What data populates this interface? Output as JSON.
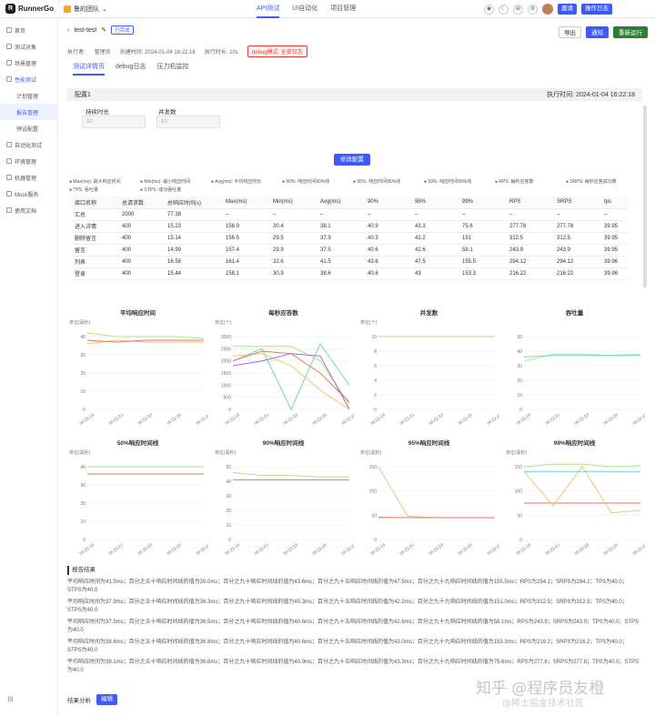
{
  "app": {
    "logo": "RunnerGo",
    "team": "鲁的团队",
    "nav": [
      "API测试",
      "UI自动化",
      "项目管理"
    ],
    "invite": "邀请",
    "log": "操作日志"
  },
  "sidebar": [
    "首页",
    "测试对象",
    "场景管理",
    "性能测试",
    "计划管理",
    "报告管理",
    "预设配置",
    "自动化测试",
    "环境管理",
    "机器管理",
    "Mock服务",
    "使用文档"
  ],
  "header": {
    "title": "test-test",
    "status": "已完成",
    "executor_label": "执行者:",
    "executor": "管理员",
    "created": "创建时间: 2024-01-04 16:22:18",
    "duration": "执行时长: 10s",
    "debug": "debug模式: 全部日志",
    "export": "导出",
    "notify": "通知",
    "rerun": "重新运行"
  },
  "tabs": [
    "测试详情页",
    "debug日志",
    "压力机监控"
  ],
  "panel": {
    "name": "配置1",
    "exec_time": "执行时间: 2024-01-04 16:22:18",
    "duration_label": "持续时长",
    "duration_val": "10",
    "conc_label": "并发数",
    "conc_val": "10",
    "modify": "修改配置"
  },
  "legend": [
    "Max(ms): 最大响应时间",
    "Min(ms): 最小响应时间",
    "Avg(ms): 平均响应时长",
    "90%: 响应时间90%线",
    "95%: 响应时间95%线",
    "99%: 响应时间99%线",
    "RPS: 每秒应答数",
    "SRPS: 每秒应答成功数",
    "TPS: 吞吐量",
    "STPS: 成功吞吐量"
  ],
  "table": {
    "headers": [
      "接口名称",
      "总请求数",
      "总响应时间(s)",
      "Max(ms)",
      "Min(ms)",
      "Avg(ms)",
      "90%",
      "95%",
      "99%",
      "RPS",
      "SRPS",
      "tps"
    ],
    "rows": [
      [
        "汇总",
        "2000",
        "77.38",
        "–",
        "–",
        "–",
        "–",
        "–",
        "–",
        "–",
        "–",
        "–"
      ],
      [
        "进入详情",
        "400",
        "15.23",
        "158.9",
        "30.4",
        "38.1",
        "40.9",
        "43.3",
        "75.6",
        "277.78",
        "277.78",
        "39.95"
      ],
      [
        "删除留言",
        "400",
        "15.14",
        "156.5",
        "29.5",
        "37.9",
        "40.3",
        "42.2",
        "151",
        "312.5",
        "312.5",
        "39.95"
      ],
      [
        "留言",
        "400",
        "14.99",
        "157.4",
        "29.9",
        "37.5",
        "40.6",
        "42.6",
        "58.1",
        "243.9",
        "243.9",
        "39.95"
      ],
      [
        "列表",
        "400",
        "16.58",
        "161.4",
        "32.6",
        "41.5",
        "43.6",
        "47.5",
        "155.5",
        "294.12",
        "294.12",
        "39.96"
      ],
      [
        "登录",
        "400",
        "15.44",
        "158.1",
        "30.9",
        "38.6",
        "40.6",
        "43",
        "153.3",
        "216.22",
        "216.22",
        "39.98"
      ]
    ]
  },
  "chart_data": [
    {
      "type": "line",
      "title": "平均响应时间",
      "ylabel": "单位(毫秒)",
      "ylim": [
        0,
        40
      ],
      "yticks": [
        "40",
        "30",
        "20",
        "10",
        "0"
      ],
      "x": [
        "16:22:19",
        "16:22:21",
        "16:22:23",
        "16:22:25",
        "16:22:27"
      ],
      "series": [
        {
          "color": "#b5e08a",
          "values": [
            45,
            40,
            40,
            40,
            39
          ]
        },
        {
          "color": "#f2c46d",
          "values": [
            36,
            38,
            37,
            37,
            37
          ]
        },
        {
          "color": "#e07a5f",
          "values": [
            38,
            37,
            38,
            38,
            38
          ]
        }
      ]
    },
    {
      "type": "line",
      "title": "每秒应答数",
      "ylabel": "单位(个)",
      "ylim": [
        0,
        3000
      ],
      "yticks": [
        "3000",
        "2500",
        "2000",
        "1500",
        "1000",
        "500",
        "0"
      ],
      "x": [
        "16:22:19",
        "16:22:21",
        "16:22:23",
        "16:22:25",
        "16:22:27"
      ],
      "series": [
        {
          "color": "#6fd6c9",
          "values": [
            2000,
            2500,
            0,
            2700,
            1000
          ]
        },
        {
          "color": "#b5e08a",
          "values": [
            2600,
            2600,
            2600,
            2000,
            200
          ]
        },
        {
          "color": "#f2c46d",
          "values": [
            2200,
            2300,
            1800,
            800,
            0
          ]
        },
        {
          "color": "#e07a5f",
          "values": [
            2000,
            2400,
            2300,
            1500,
            300
          ]
        },
        {
          "color": "#9c6bdc",
          "values": [
            1800,
            2000,
            2300,
            2200,
            0
          ]
        }
      ]
    },
    {
      "type": "line",
      "title": "并发数",
      "ylabel": "单位(个)",
      "ylim": [
        0,
        10
      ],
      "yticks": [
        "10",
        "8",
        "6",
        "4",
        "2",
        "0"
      ],
      "x": [
        "16:22:19",
        "16:22:21",
        "16:22:23",
        "16:22:25",
        "16:22:27"
      ],
      "series": [
        {
          "color": "#b5e08a",
          "values": [
            10,
            10,
            10,
            10,
            10
          ]
        }
      ]
    },
    {
      "type": "line",
      "title": "吞吐量",
      "ylabel": "",
      "ylim": [
        0,
        50
      ],
      "yticks": [
        "50",
        "40",
        "30",
        "20",
        "10",
        "0"
      ],
      "x": [
        "16:22:19",
        "16:22:21",
        "16:22:23",
        "16:22:25",
        "16:22:27"
      ],
      "series": [
        {
          "color": "#b5e08a",
          "values": [
            33,
            38,
            38,
            37,
            38
          ]
        },
        {
          "color": "#6fd6c9",
          "values": [
            36,
            37,
            37,
            37,
            37
          ]
        }
      ]
    },
    {
      "type": "line",
      "title": "50%响应时间线",
      "ylabel": "单位(毫秒)",
      "ylim": [
        0,
        40
      ],
      "yticks": [
        "40",
        "30",
        "20",
        "10",
        "0"
      ],
      "x": [
        "16:22:19",
        "16:22:21",
        "16:22:23",
        "16:22:25",
        "16:22:27"
      ],
      "series": [
        {
          "color": "#b5e08a",
          "values": [
            40,
            40,
            40,
            40,
            40
          ]
        },
        {
          "color": "#e07a5f",
          "values": [
            36,
            36,
            36,
            36,
            36
          ]
        }
      ]
    },
    {
      "type": "line",
      "title": "90%响应时间线",
      "ylabel": "单位(毫秒)",
      "ylim": [
        0,
        50
      ],
      "yticks": [
        "50",
        "40",
        "30",
        "20",
        "10",
        "0"
      ],
      "x": [
        "16:22:19",
        "16:22:21",
        "16:22:23",
        "16:22:25",
        "16:22:27"
      ],
      "series": [
        {
          "color": "#b5e08a",
          "values": [
            46,
            44,
            44,
            43,
            43
          ]
        },
        {
          "color": "#e07a5f",
          "values": [
            41,
            41,
            41,
            41,
            41
          ]
        }
      ]
    },
    {
      "type": "line",
      "title": "95%响应时间线",
      "ylabel": "单位(毫秒)",
      "ylim": [
        0,
        150
      ],
      "yticks": [
        "150",
        "100",
        "50",
        "0"
      ],
      "x": [
        "16:22:19",
        "16:22:21",
        "16:22:23",
        "16:22:25",
        "16:22:27"
      ],
      "series": [
        {
          "color": "#b5e08a",
          "values": [
            150,
            48,
            45,
            45,
            45
          ]
        },
        {
          "color": "#e07a5f",
          "values": [
            46,
            45,
            45,
            45,
            45
          ]
        }
      ]
    },
    {
      "type": "line",
      "title": "99%响应时间线",
      "ylabel": "单位(毫秒)",
      "ylim": [
        0,
        150
      ],
      "yticks": [
        "150",
        "100",
        "50",
        "0"
      ],
      "x": [
        "16:22:19",
        "16:22:21",
        "16:22:23",
        "16:22:25",
        "16:22:27"
      ],
      "series": [
        {
          "color": "#b5e08a",
          "values": [
            150,
            155,
            155,
            150,
            152
          ]
        },
        {
          "color": "#e07a5f",
          "values": [
            75,
            75,
            75,
            75,
            75
          ]
        },
        {
          "color": "#f2c46d",
          "values": [
            140,
            70,
            150,
            55,
            60
          ]
        },
        {
          "color": "#6fd6c9",
          "values": [
            140,
            140,
            140,
            140,
            140
          ]
        }
      ]
    }
  ],
  "report": {
    "title": "报告结果",
    "lines": [
      "平均响应时间为41.5ms；百分之五十响应时间线的值为39.0ms；百分之九十响应时间线的值为43.6ms；百分之九十五响应时间线的值为47.5ms；百分之九十九响应时间线的值为155.5ms；RPS为294.1；SRPS为294.1；TPS为40.0；STPS为40.0",
      "平均响应时间为37.9ms；百分之五十响应时间线的值为36.3ms；百分之九十响应时间线的值为40.3ms；百分之九十五响应时间线的值为42.2ms；百分之九十九响应时间线的值为151.0ms；RPS为312.5；SRPS为312.5；TPS为40.0；STPS为40.0",
      "平均响应时间为37.5ms；百分之五十响应时间线的值为36.5ms；百分之九十响应时间线的值为40.6ms；百分之九十五响应时间线的值为42.6ms；百分之九十九响应时间线的值为58.1ms；RPS为243.9；SRPS为243.9；TPS为40.0；STPS为40.0",
      "平均响应时间为38.6ms；百分之五十响应时间线的值为36.8ms；百分之九十响应时间线的值为40.6ms；百分之九十五响应时间线的值为43.0ms；百分之九十九响应时间线的值为153.3ms；RPS为216.2；SRPS为216.2；TPS为40.0；STPS为40.0",
      "平均响应时间为38.1ms；百分之五十响应时间线的值为36.8ms；百分之九十响应时间线的值为40.9ms；百分之九十五响应时间线的值为43.3ms；百分之九十九响应时间线的值为75.6ms；RPS为277.8；SRPS为277.8；TPS为40.0；STPS为40.0"
    ]
  },
  "analysis": {
    "label": "结果分析",
    "edit": "编辑"
  },
  "watermark": {
    "main": "知乎 @程序员友橙",
    "sub": "@稀土掘金技术社区"
  }
}
